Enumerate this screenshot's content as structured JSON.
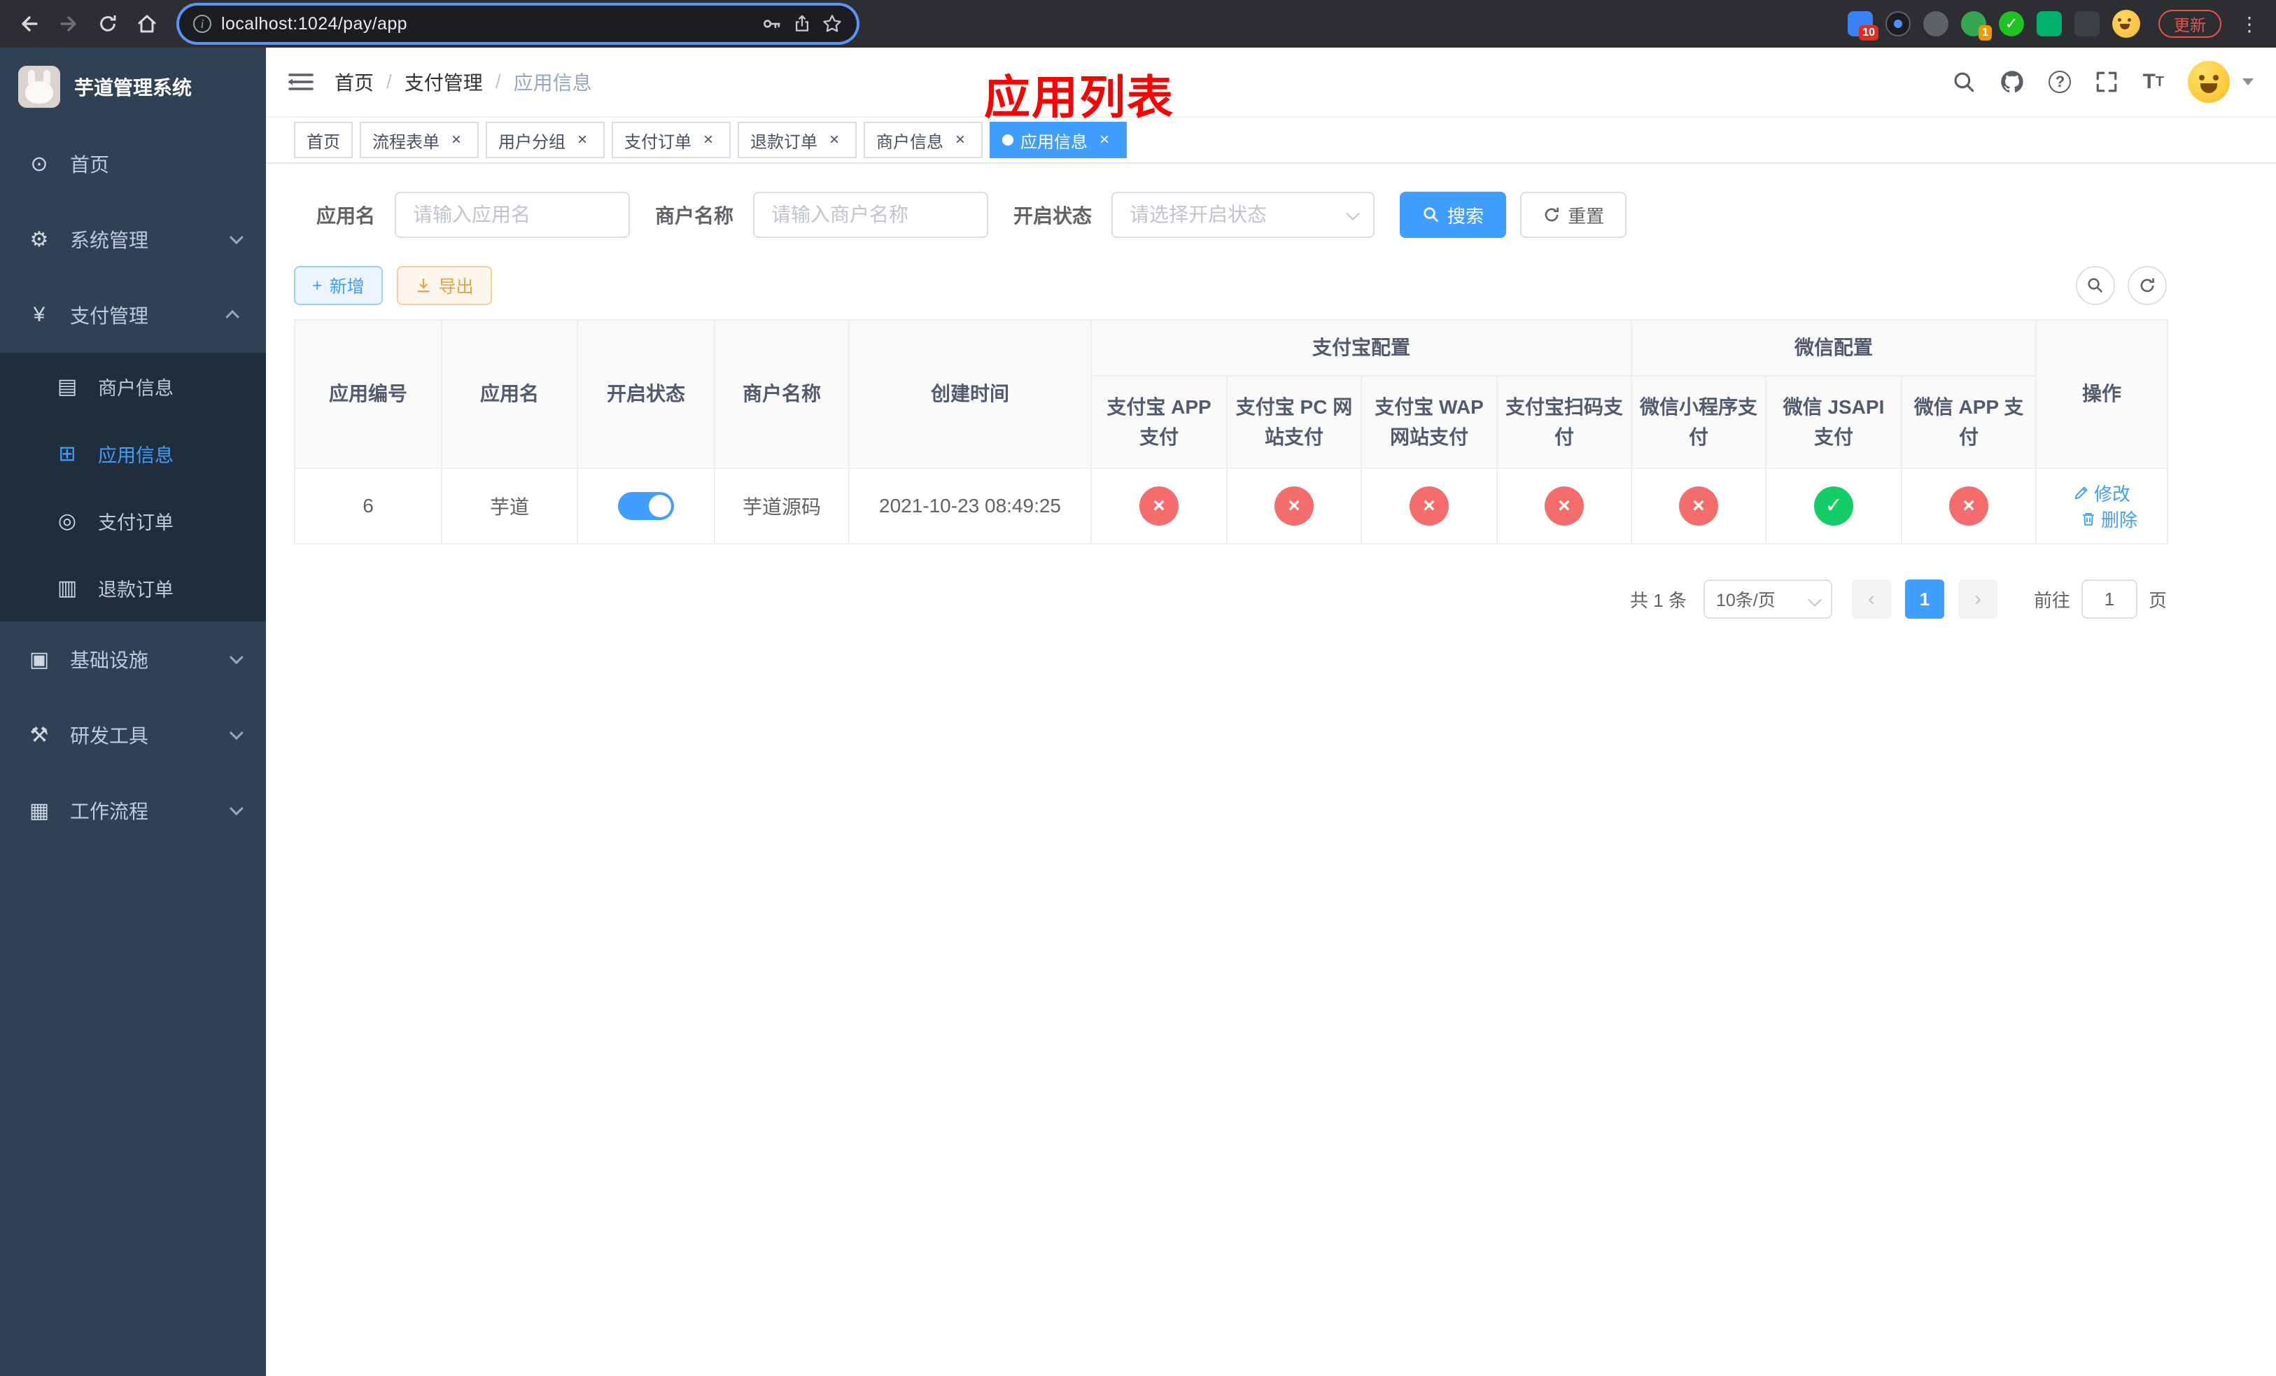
{
  "colors": {
    "primary": "#409eff",
    "success": "#13ce66",
    "danger": "#f56c6c",
    "warning": "#e6a23c",
    "sidebar_bg": "#304156",
    "submenu_bg": "#1f2d3d",
    "annotation_red": "#ff0000"
  },
  "browser": {
    "url": "localhost:1024/pay/app",
    "update_label": "更新",
    "extensions_badge": "10",
    "profile_badge": "1"
  },
  "app": {
    "logo_title": "芋道管理系统",
    "annotation_title": "应用列表"
  },
  "sidebar": {
    "items": [
      {
        "label": "首页"
      },
      {
        "label": "系统管理"
      },
      {
        "label": "支付管理"
      },
      {
        "label": "基础设施"
      },
      {
        "label": "研发工具"
      },
      {
        "label": "工作流程"
      }
    ],
    "pay_children": [
      {
        "label": "商户信息"
      },
      {
        "label": "应用信息"
      },
      {
        "label": "支付订单"
      },
      {
        "label": "退款订单"
      }
    ]
  },
  "breadcrumb": [
    "首页",
    "支付管理",
    "应用信息"
  ],
  "tabs": [
    {
      "label": "首页"
    },
    {
      "label": "流程表单"
    },
    {
      "label": "用户分组"
    },
    {
      "label": "支付订单"
    },
    {
      "label": "退款订单"
    },
    {
      "label": "商户信息"
    },
    {
      "label": "应用信息"
    }
  ],
  "filters": {
    "app_name_label": "应用名",
    "app_name_placeholder": "请输入应用名",
    "merchant_label": "商户名称",
    "merchant_placeholder": "请输入商户名称",
    "status_label": "开启状态",
    "status_placeholder": "请选择开启状态",
    "search_label": "搜索",
    "reset_label": "重置"
  },
  "toolbar": {
    "add_label": "新增",
    "export_label": "导出"
  },
  "table": {
    "columns": {
      "id": "应用编号",
      "name": "应用名",
      "status": "开启状态",
      "merchant": "商户名称",
      "created": "创建时间",
      "actions": "操作"
    },
    "groups": {
      "alipay": {
        "label": "支付宝配置",
        "columns": [
          "支付宝 APP 支付",
          "支付宝 PC 网站支付",
          "支付宝 WAP 网站支付",
          "支付宝扫码支付"
        ]
      },
      "wechat": {
        "label": "微信配置",
        "columns": [
          "微信小程序支付",
          "微信 JSAPI 支付",
          "微信 APP 支付"
        ]
      }
    },
    "rows": [
      {
        "id": "6",
        "name": "芋道",
        "enabled": true,
        "merchant": "芋道源码",
        "created": "2021-10-23 08:49:25",
        "statuses": [
          false,
          false,
          false,
          false,
          false,
          true,
          false
        ],
        "edit_label": "修改",
        "delete_label": "删除"
      }
    ]
  },
  "pagination": {
    "total": "共 1 条",
    "page_size": "10条/页",
    "page": "1",
    "goto_label": "前往",
    "goto_value": "1",
    "unit_label": "页"
  }
}
